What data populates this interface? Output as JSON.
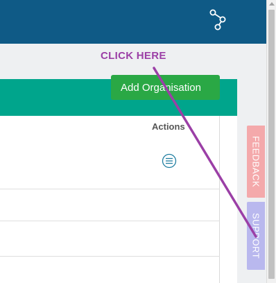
{
  "annotation": {
    "label": "CLICK HERE"
  },
  "toolbar": {
    "add_organisation_label": "Add Organisation"
  },
  "table": {
    "columns": [
      "",
      "Actions"
    ],
    "row_action_icon": "list-menu-icon"
  },
  "side_tabs": {
    "feedback_label": "FEEDBACK",
    "support_label": "SUPPORT"
  },
  "colors": {
    "topbar": "#0f5a86",
    "teal_header": "#00a58c",
    "add_button": "#2aa845",
    "annotation": "#9b3fa6",
    "feedback_tab": "#f4a9ab",
    "support_tab": "#b9b8ee"
  }
}
